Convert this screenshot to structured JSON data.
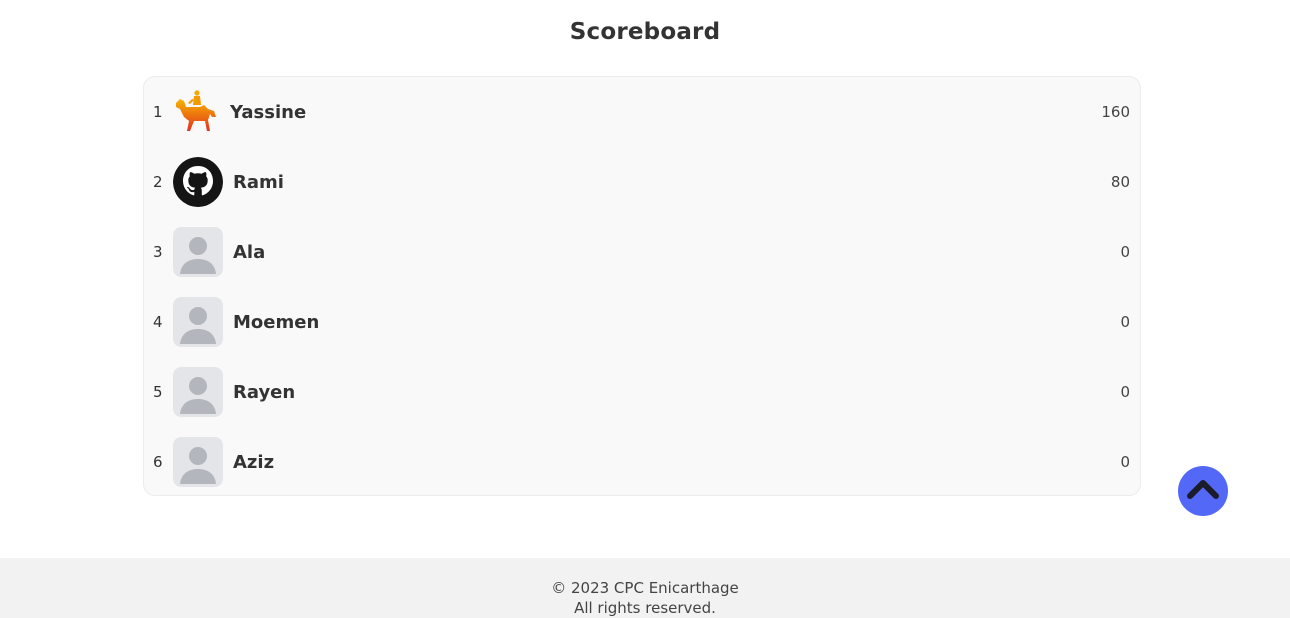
{
  "page": {
    "title": "Scoreboard"
  },
  "scoreboard": {
    "rows": [
      {
        "rank": "1",
        "name": "Yassine",
        "score": "160",
        "avatar": "horse-rider-icon"
      },
      {
        "rank": "2",
        "name": "Rami",
        "score": "80",
        "avatar": "github-icon"
      },
      {
        "rank": "3",
        "name": "Ala",
        "score": "0",
        "avatar": "default-user-icon"
      },
      {
        "rank": "4",
        "name": "Moemen",
        "score": "0",
        "avatar": "default-user-icon"
      },
      {
        "rank": "5",
        "name": "Rayen",
        "score": "0",
        "avatar": "default-user-icon"
      },
      {
        "rank": "6",
        "name": "Aziz",
        "score": "0",
        "avatar": "default-user-icon"
      }
    ]
  },
  "scroll_top": {
    "icon": "chevron-up-icon",
    "color": "#5468f7"
  },
  "footer": {
    "copyright": "© 2023 CPC Enicarthage",
    "rights": "All rights reserved."
  }
}
